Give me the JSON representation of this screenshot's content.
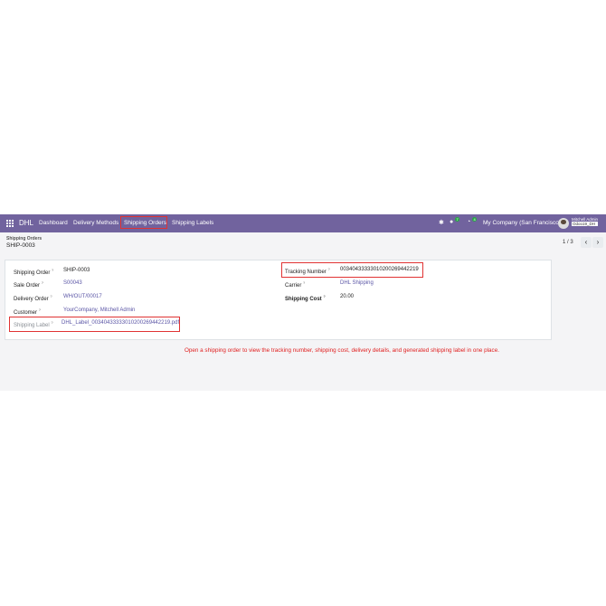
{
  "topbar": {
    "brand": "DHL",
    "nav": [
      "Dashboard",
      "Delivery Methods",
      "Shipping Orders",
      "Shipping Labels"
    ],
    "activity_badge": "7",
    "clock_badge": "4",
    "company": "My Company (San Francisco)",
    "user_name": "Mitchell Admin",
    "user_db": "Odoo19_DH"
  },
  "header": {
    "breadcrumb": "Shipping Orders",
    "record": "SHIP-0003",
    "pager": "1 / 3"
  },
  "form": {
    "shipping_order_label": "Shipping Order",
    "shipping_order_value": "SHIP-0003",
    "sale_order_label": "Sale Order",
    "sale_order_value": "S00043",
    "delivery_order_label": "Delivery Order",
    "delivery_order_value": "WH/OUT/00017",
    "customer_label": "Customer",
    "customer_value": "YourCompany, Mitchell Admin",
    "shipping_label_label": "Shipping Label",
    "shipping_label_value": "DHL_Label_00340433333010200269442219.pdf",
    "tracking_label": "Tracking Number",
    "tracking_value": "00340433333010200269442219",
    "carrier_label": "Carrier",
    "carrier_value": "DHL Shipping",
    "cost_label": "Shipping Cost",
    "cost_value": "20.00",
    "help_mark": "?"
  },
  "note": "Open a shipping order to view the tracking number, shipping cost, delivery details, and generated shipping label in one place.",
  "colors": {
    "topbar": "#71639e",
    "highlight": "#e03333",
    "link": "#5b56a6"
  }
}
